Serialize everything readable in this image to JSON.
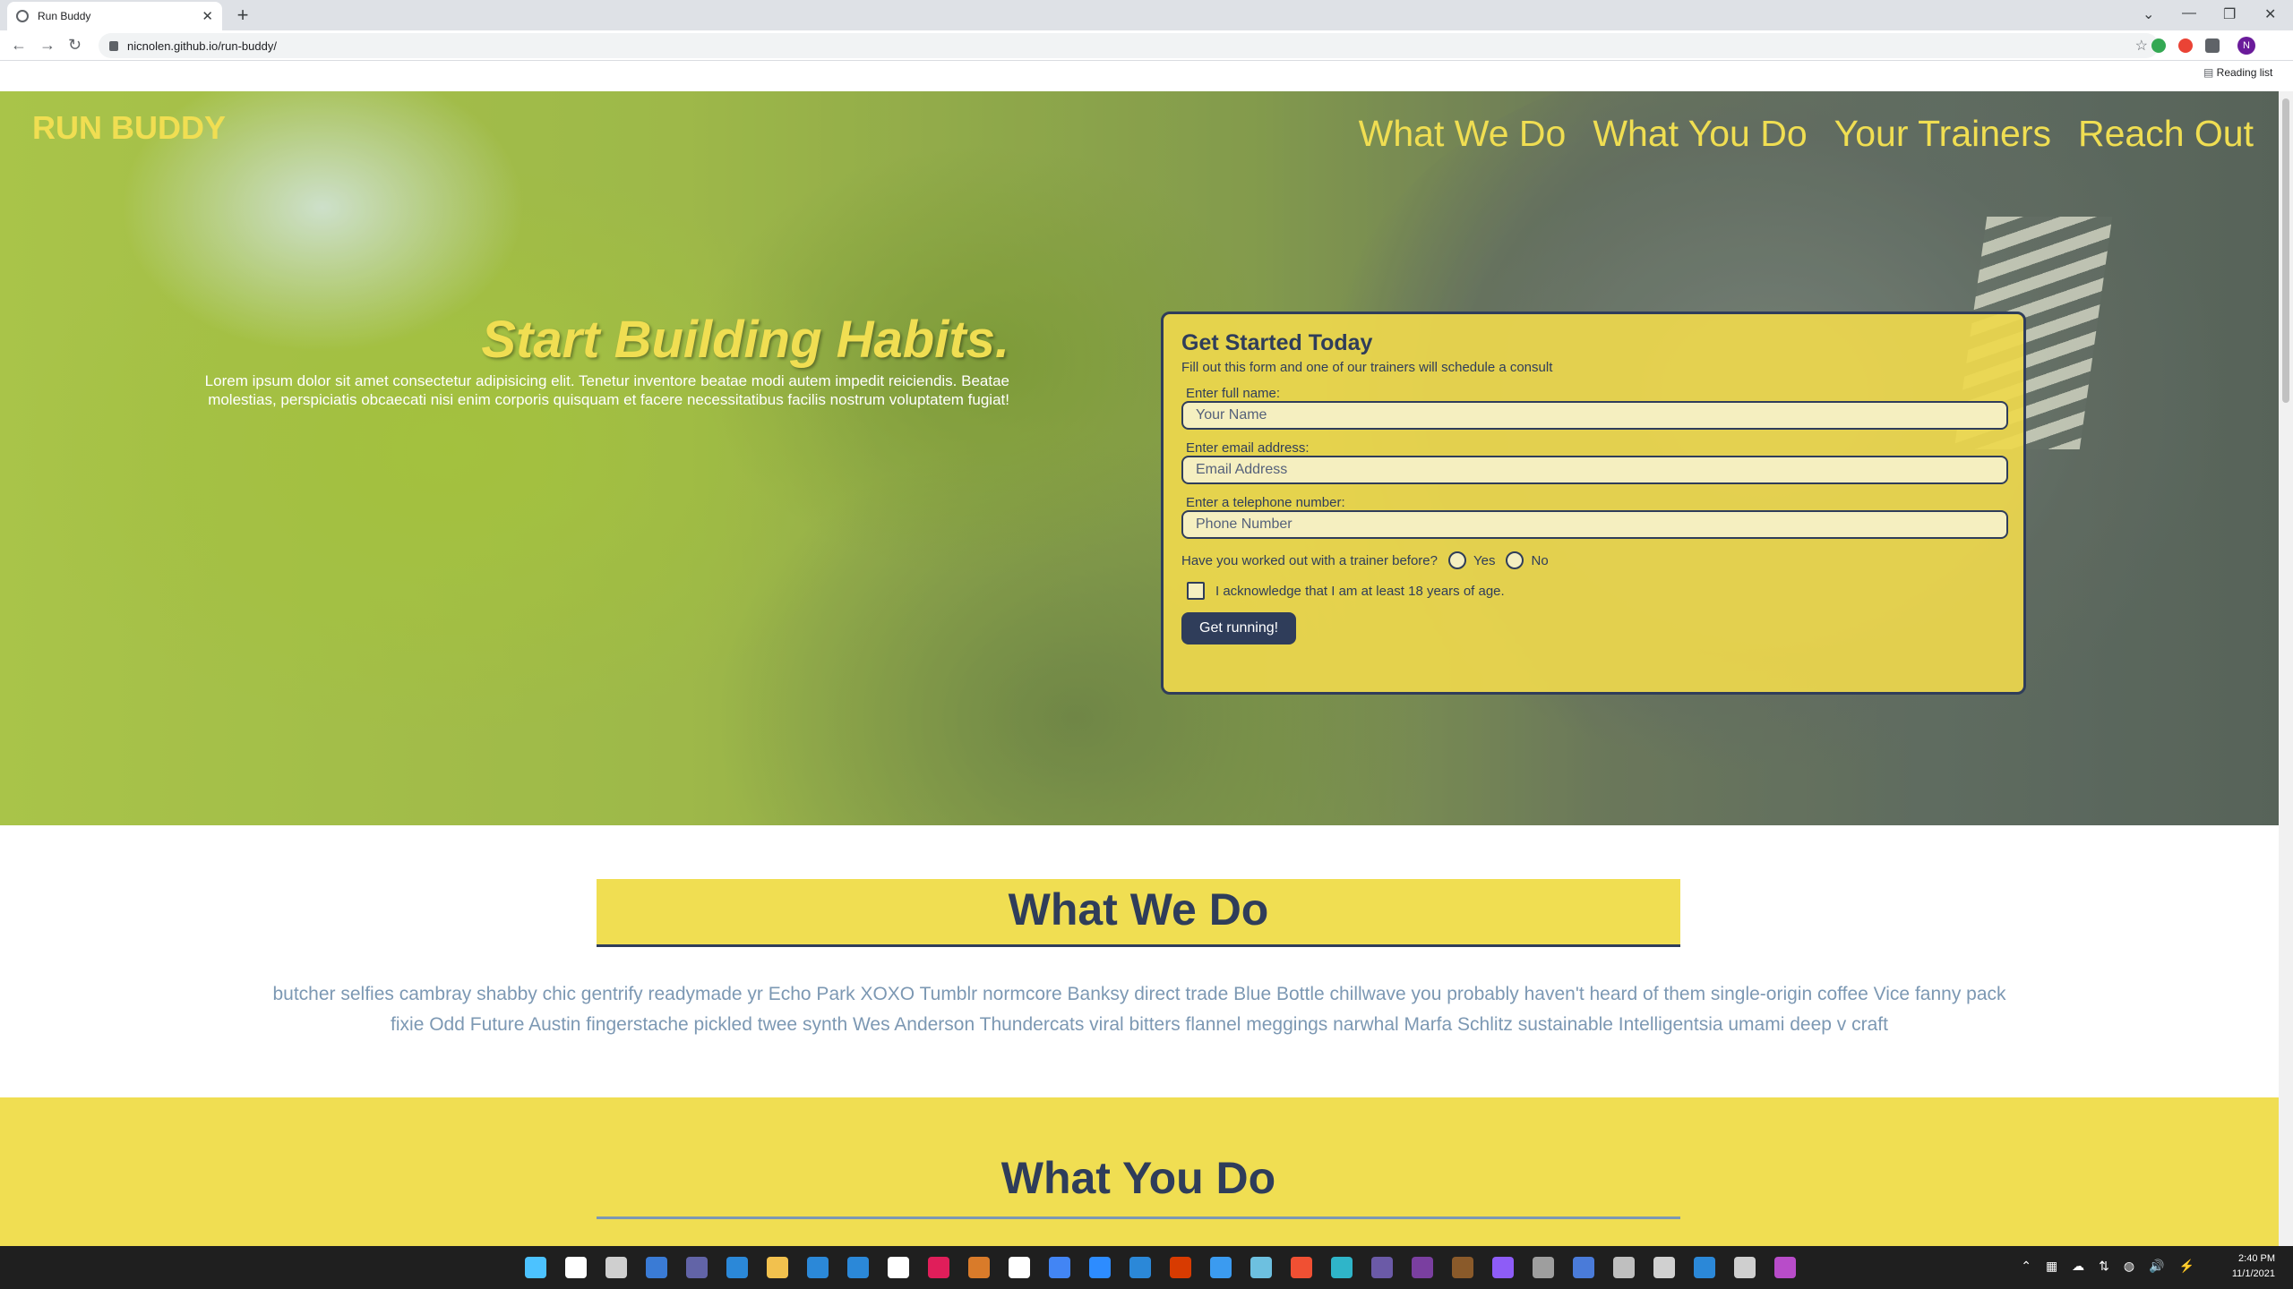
{
  "browser": {
    "tab_title": "Run Buddy",
    "tab_close": "✕",
    "new_tab": "+",
    "url": "nicnolen.github.io/run-buddy/",
    "back": "←",
    "forward": "→",
    "reload": "↻",
    "star": "☆",
    "profile_initial": "N",
    "reading_list": "Reading list",
    "window_controls": {
      "chevron": "⌄",
      "minimize": "—",
      "restore": "❐",
      "close": "✕"
    }
  },
  "site": {
    "brand": "RUN BUDDY",
    "nav": [
      "What We Do",
      "What You Do",
      "Your Trainers",
      "Reach Out"
    ],
    "hero": {
      "headline": "Start Building Habits.",
      "body": "Lorem ipsum dolor sit amet consectetur adipisicing elit. Tenetur inventore beatae modi autem impedit reiciendis. Beatae molestias, perspiciatis obcaecati nisi enim corporis quisquam et facere necessitatibus facilis nostrum voluptatem fugiat!"
    },
    "form": {
      "title": "Get Started Today",
      "subtitle": "Fill out this form and one of our trainers will schedule a consult",
      "name_label": "Enter full name:",
      "name_placeholder": "Your Name",
      "email_label": "Enter email address:",
      "email_placeholder": "Email Address",
      "phone_label": "Enter a telephone number:",
      "phone_placeholder": "Phone Number",
      "trainer_question": "Have you worked out with a trainer before?",
      "yes_label": "Yes",
      "no_label": "No",
      "age_ack": "I acknowledge that I am at least 18 years of age.",
      "submit_label": "Get running!"
    },
    "what_we_do": {
      "heading": "What We Do",
      "body": "butcher selfies cambray shabby chic gentrify readymade yr Echo Park XOXO Tumblr normcore Banksy direct trade Blue Bottle chillwave you probably haven't heard of them single-origin coffee Vice fanny pack fixie Odd Future Austin fingerstache pickled twee synth Wes Anderson Thundercats viral bitters flannel meggings narwhal Marfa Schlitz sustainable Intelligentsia umami deep v craft"
    },
    "what_you_do": {
      "heading": "What You Do"
    }
  },
  "taskbar": {
    "time": "2:40 PM",
    "date": "11/1/2021",
    "apps": [
      "start-icon",
      "search-icon",
      "task-view-icon",
      "widgets-icon",
      "teams-chat-icon",
      "store-icon",
      "file-explorer-icon",
      "calendar-icon",
      "mail-icon",
      "calendar-app-icon",
      "slack-icon",
      "app-icon",
      "github-icon",
      "chrome-icon",
      "zoom-icon",
      "photos-icon",
      "office-icon",
      "vscode-icon",
      "notepad-icon",
      "git-icon",
      "edge-icon",
      "app-icon",
      "app-icon",
      "app-icon",
      "app-icon",
      "camera-icon",
      "app-icon",
      "app-icon",
      "app-icon",
      "app-icon",
      "settings-icon",
      "onenote-icon"
    ],
    "app_colors": [
      "#4cc2ff",
      "#ffffff",
      "#cfcfcf",
      "#3a7bd5",
      "#6264a7",
      "#2b88d8",
      "#f2c14e",
      "#2b88d8",
      "#2b88d8",
      "#ffffff",
      "#e01e5a",
      "#d97b2a",
      "#ffffff",
      "#4285f4",
      "#2d8cff",
      "#2b88d8",
      "#d83b01",
      "#3b9bf0",
      "#6dc0e0",
      "#f05033",
      "#2fb5c9",
      "#6b5aa7",
      "#7a3fa0",
      "#8a5a2a",
      "#8e5cf7",
      "#9e9e9e",
      "#4a7bd9",
      "#bfbfbf",
      "#d0d0d0",
      "#2b88d8",
      "#cfcfcf",
      "#b84cc9"
    ],
    "tray": [
      "⌃",
      "▦",
      "☁",
      "⇅",
      "◍",
      "🔊",
      "⚡"
    ],
    "colors": {
      "accent": "#f0de52",
      "navy": "#2f3d5a",
      "muted_blue": "#7c98b3"
    }
  }
}
